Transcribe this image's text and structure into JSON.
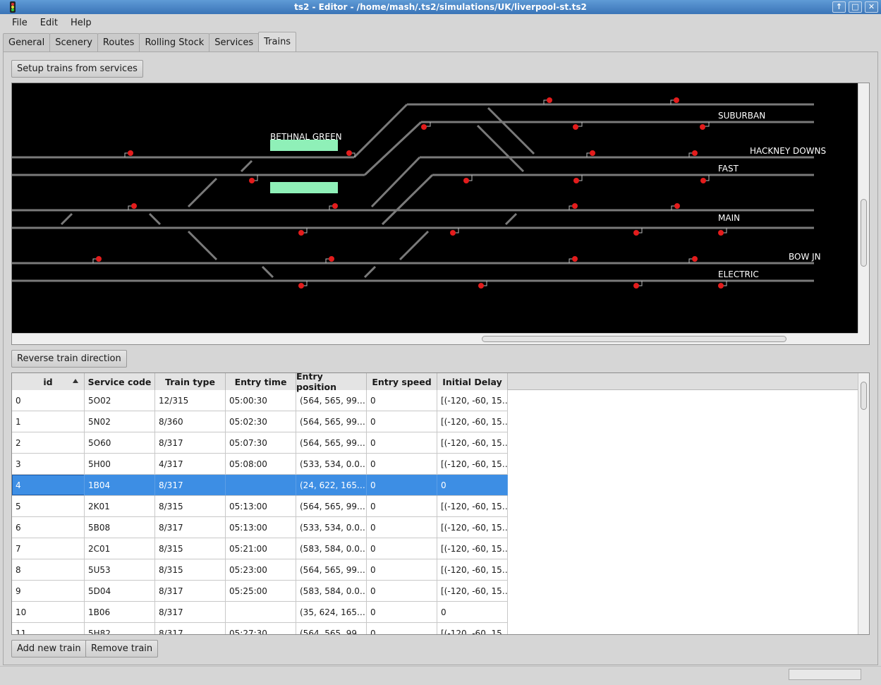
{
  "window": {
    "title": "ts2 - Editor - /home/mash/.ts2/simulations/UK/liverpool-st.ts2"
  },
  "menu": [
    "File",
    "Edit",
    "Help"
  ],
  "tabs": [
    {
      "label": "General",
      "active": false
    },
    {
      "label": "Scenery",
      "active": false
    },
    {
      "label": "Routes",
      "active": false
    },
    {
      "label": "Rolling Stock",
      "active": false
    },
    {
      "label": "Services",
      "active": false
    },
    {
      "label": "Trains",
      "active": true
    }
  ],
  "buttons": {
    "setup_trains": "Setup trains from services",
    "reverse_direction": "Reverse train direction",
    "add_train": "Add new train",
    "remove_train": "Remove train"
  },
  "scenery": {
    "labels": {
      "bethnal_green": "BETHNAL GREEN",
      "suburban": "SUBURBAN",
      "hackney_downs": "HACKNEY DOWNS",
      "fast": "FAST",
      "main": "MAIN",
      "bow_jn": "BOW JN",
      "electric": "ELECTRIC"
    },
    "colors": {
      "track": "#7a7a7a",
      "signal": "#e31c1c",
      "platform": "#8ff0b8",
      "background": "#000000"
    }
  },
  "table": {
    "columns": [
      "id",
      "Service code",
      "Train type",
      "Entry time",
      "Entry position",
      "Entry speed",
      "Initial Delay"
    ],
    "sorted_by": "id",
    "selected_row": 4,
    "rows": [
      [
        "0",
        "5O02",
        "12/315",
        "05:00:30",
        "(564, 565, 99.…",
        "0",
        "[(-120, -60, 15…"
      ],
      [
        "1",
        "5N02",
        "8/360",
        "05:02:30",
        "(564, 565, 99.…",
        "0",
        "[(-120, -60, 15…"
      ],
      [
        "2",
        "5O60",
        "8/317",
        "05:07:30",
        "(564, 565, 99.…",
        "0",
        "[(-120, -60, 15…"
      ],
      [
        "3",
        "5H00",
        "4/317",
        "05:08:00",
        "(533, 534, 0.0…",
        "0",
        "[(-120, -60, 15…"
      ],
      [
        "4",
        "1B04",
        "8/317",
        "",
        "(24, 622, 165.…",
        "0",
        "0"
      ],
      [
        "5",
        "2K01",
        "8/315",
        "05:13:00",
        "(564, 565, 99.…",
        "0",
        "[(-120, -60, 15…"
      ],
      [
        "6",
        "5B08",
        "8/317",
        "05:13:00",
        "(533, 534, 0.0…",
        "0",
        "[(-120, -60, 15…"
      ],
      [
        "7",
        "2C01",
        "8/315",
        "05:21:00",
        "(583, 584, 0.0…",
        "0",
        "[(-120, -60, 15…"
      ],
      [
        "8",
        "5U53",
        "8/315",
        "05:23:00",
        "(564, 565, 99.…",
        "0",
        "[(-120, -60, 15…"
      ],
      [
        "9",
        "5D04",
        "8/317",
        "05:25:00",
        "(583, 584, 0.0…",
        "0",
        "[(-120, -60, 15…"
      ],
      [
        "10",
        "1B06",
        "8/317",
        "",
        "(35, 624, 165.…",
        "0",
        "0"
      ],
      [
        "11",
        "5H82",
        "8/317",
        "05:27:30",
        "(564, 565, 99.…",
        "0",
        "[(-120, -60, 15…"
      ]
    ]
  }
}
